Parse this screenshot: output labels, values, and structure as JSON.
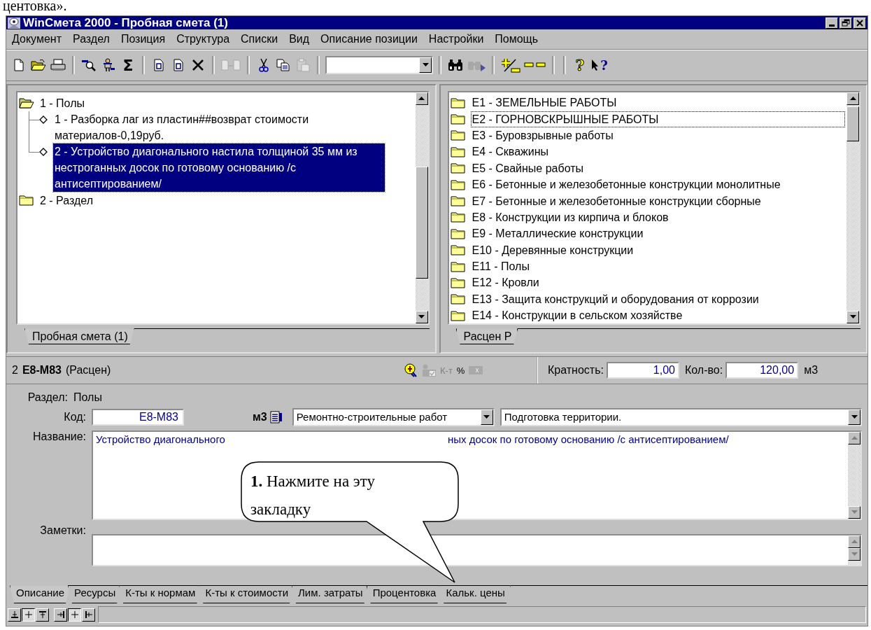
{
  "page_caption": "центовка».",
  "window": {
    "title": "WinСмета 2000 - Пробная смета (1)"
  },
  "menu": [
    {
      "label": "Документ"
    },
    {
      "label": "Раздел"
    },
    {
      "label": "Позиция"
    },
    {
      "label": "Структура"
    },
    {
      "label": "Списки"
    },
    {
      "label": "Вид"
    },
    {
      "label": "Описание позиции"
    },
    {
      "label": "Настройки"
    },
    {
      "label": "Помощь"
    }
  ],
  "toolbar": [
    {
      "kind": "new",
      "disabled": false
    },
    {
      "kind": "open",
      "disabled": false
    },
    {
      "kind": "print",
      "disabled": false
    },
    {
      "kind": "separator"
    },
    {
      "kind": "magnifier",
      "disabled": false
    },
    {
      "kind": "person",
      "disabled": false
    },
    {
      "kind": "text",
      "label": "Σ",
      "disabled": false
    },
    {
      "kind": "separator"
    },
    {
      "kind": "doc",
      "disabled": false
    },
    {
      "kind": "doc",
      "disabled": false
    },
    {
      "kind": "delete",
      "disabled": false
    },
    {
      "kind": "separator"
    },
    {
      "kind": "transfer",
      "disabled": true
    },
    {
      "kind": "separator"
    },
    {
      "kind": "cut",
      "disabled": false
    },
    {
      "kind": "copy",
      "disabled": false
    },
    {
      "kind": "paste",
      "disabled": true
    },
    {
      "kind": "separator"
    },
    {
      "kind": "combo"
    },
    {
      "kind": "separator"
    },
    {
      "kind": "find",
      "disabled": false
    },
    {
      "kind": "find-next",
      "disabled": true
    },
    {
      "kind": "separator"
    },
    {
      "kind": "plus-minus",
      "disabled": false
    },
    {
      "kind": "dashes",
      "disabled": false
    },
    {
      "kind": "separator"
    },
    {
      "kind": "separator"
    },
    {
      "kind": "help",
      "label": "?",
      "disabled": false
    },
    {
      "kind": "pointer-help",
      "label": "?",
      "disabled": false
    }
  ],
  "left_tree": [
    {
      "label": "1 - Полы",
      "kind": "folder",
      "expanded": true,
      "selected": false,
      "children": [
        {
          "label": "1 - Разборка лаг из пластин##возврат стоимости материалов-0,19руб.",
          "kind": "position",
          "selected": false
        },
        {
          "label": "2 - Устройство диагонального настила толщиной 35 мм из нестроганных досок по готовому основанию /с антисептированием/",
          "kind": "position",
          "selected": true
        }
      ]
    },
    {
      "label": "2 - Раздел",
      "kind": "folder",
      "expanded": false,
      "selected": false
    }
  ],
  "left_tab": {
    "label": "Пробная смета (1)",
    "selected": true
  },
  "right_tree": [
    {
      "label": "E1 - ЗЕМЕЛЬНЫЕ РАБОТЫ",
      "focused": false
    },
    {
      "label": "E2 - ГОРНОВСКРЫШНЫЕ РАБОТЫ",
      "focused": true
    },
    {
      "label": "E3 - Буровзрывные работы",
      "focused": false
    },
    {
      "label": "E4 - Скважины",
      "focused": false
    },
    {
      "label": "E5 - Свайные работы",
      "focused": false
    },
    {
      "label": "E6 - Бетонные и железобетонные конструкции монолитные",
      "focused": false
    },
    {
      "label": "E7 - Бетонные и железобетонные конструкции сборные",
      "focused": false
    },
    {
      "label": "E8 - Конструкции из кирпича и блоков",
      "focused": false
    },
    {
      "label": "E9 - Металлические конструкции",
      "focused": false
    },
    {
      "label": "E10 - Деревянные конструкции",
      "focused": false
    },
    {
      "label": "E11 - Полы",
      "focused": false
    },
    {
      "label": "E12 - Кровли",
      "focused": false
    },
    {
      "label": "E13 - Защита конструкций и оборудования от коррозии",
      "focused": false
    },
    {
      "label": "E14 - Конструкции в сельском хозяйстве",
      "focused": false
    }
  ],
  "right_tab": {
    "label": "Расцен Р",
    "selected": true
  },
  "info_bar": {
    "number": "2",
    "code": "E8-M83",
    "source": "(Расцен)",
    "tools": [
      {
        "kind": "coin",
        "disabled": false
      },
      {
        "kind": "person-table",
        "disabled": true
      },
      {
        "kind": "text",
        "label": "К-т",
        "disabled": true
      },
      {
        "kind": "text",
        "label": "%",
        "disabled": false
      },
      {
        "kind": "grid",
        "disabled": true
      }
    ],
    "multiplicity": {
      "label": "Кратность:",
      "value": "1,00"
    },
    "quantity": {
      "label": "Кол-во:",
      "value": "120,00"
    },
    "unit": "м3"
  },
  "details": {
    "section_label": "Раздел:",
    "section_value": "Полы",
    "code": {
      "label": "Код:",
      "value": "E8-M83"
    },
    "unit": "м3",
    "work_type": {
      "value": "Ремонтно-строительные работ"
    },
    "work_group": {
      "value": "Подготовка территории."
    },
    "name": {
      "label": "Название:",
      "visible_parts": [
        "Устройство диагонального",
        "ных досок по готовому основанию /с антисептированием/"
      ]
    },
    "notes": {
      "label": "Заметки:"
    }
  },
  "bottom_tabs": [
    {
      "label": "Описание",
      "selected": true
    },
    {
      "label": "Ресурсы",
      "selected": false
    },
    {
      "label": "К-ты к нормам",
      "selected": false
    },
    {
      "label": "К-ты к стоимости",
      "selected": false
    },
    {
      "label": "Лим. затраты",
      "selected": false
    },
    {
      "label": "Процентовка",
      "selected": false
    },
    {
      "label": "Кальк. цены",
      "selected": false
    }
  ],
  "status_buttons": [
    {
      "kind": "align-bottom",
      "selected": false
    },
    {
      "kind": "align-middle",
      "selected": true
    },
    {
      "kind": "align-top",
      "selected": false
    },
    {
      "kind": "align-right",
      "selected": false
    },
    {
      "kind": "align-center",
      "selected": true
    },
    {
      "kind": "align-left",
      "selected": false
    }
  ],
  "callout": {
    "text": "**1.** Нажмите на эту закладку"
  }
}
